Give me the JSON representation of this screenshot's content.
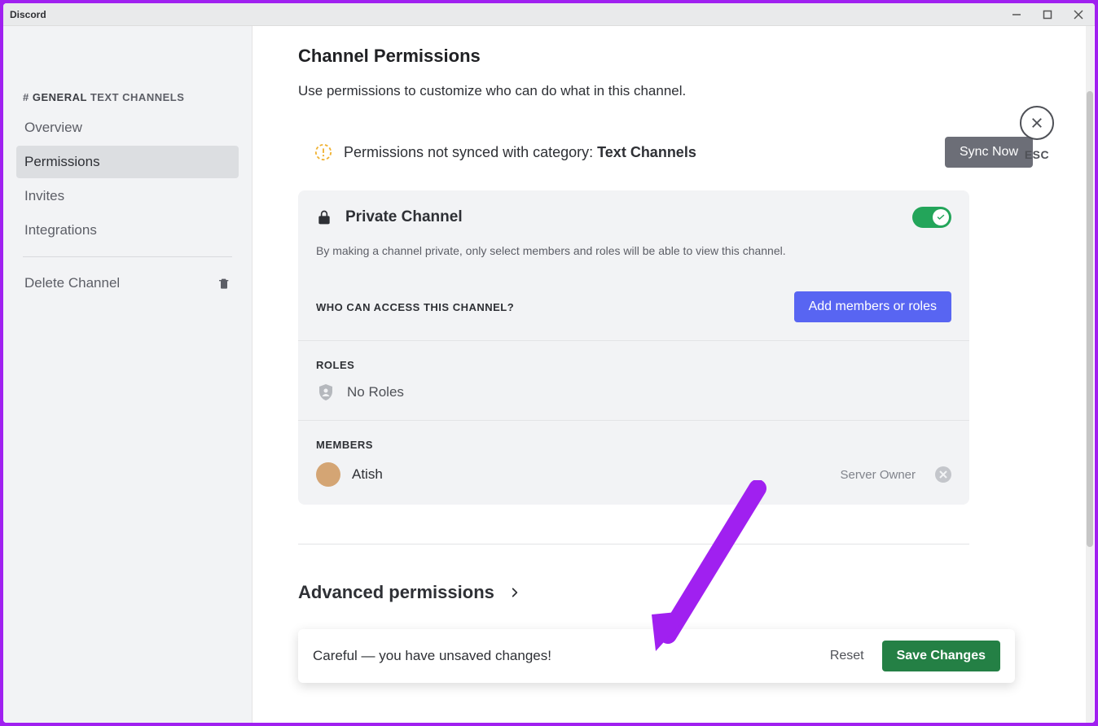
{
  "window": {
    "title": "Discord"
  },
  "sidebar": {
    "header_hash": "#",
    "header_bold": "GENERAL",
    "header_rest": "TEXT CHANNELS",
    "items": [
      {
        "label": "Overview"
      },
      {
        "label": "Permissions"
      },
      {
        "label": "Invites"
      },
      {
        "label": "Integrations"
      }
    ],
    "delete_label": "Delete Channel"
  },
  "esc": {
    "label": "ESC"
  },
  "page": {
    "title": "Channel Permissions",
    "subtitle": "Use permissions to customize who can do what in this channel."
  },
  "sync": {
    "text_prefix": "Permissions not synced with category: ",
    "category": "Text Channels",
    "button": "Sync Now"
  },
  "private": {
    "title": "Private Channel",
    "desc": "By making a channel private, only select members and roles will be able to view this channel.",
    "toggle_on": true
  },
  "access": {
    "label": "WHO CAN ACCESS THIS CHANNEL?",
    "add_button": "Add members or roles"
  },
  "roles": {
    "label": "ROLES",
    "empty": "No Roles"
  },
  "members": {
    "label": "MEMBERS",
    "items": [
      {
        "name": "Atish",
        "tag": "Server Owner"
      }
    ]
  },
  "advanced": {
    "title": "Advanced permissions"
  },
  "unsaved": {
    "text": "Careful — you have unsaved changes!",
    "reset": "Reset",
    "save": "Save Changes"
  }
}
